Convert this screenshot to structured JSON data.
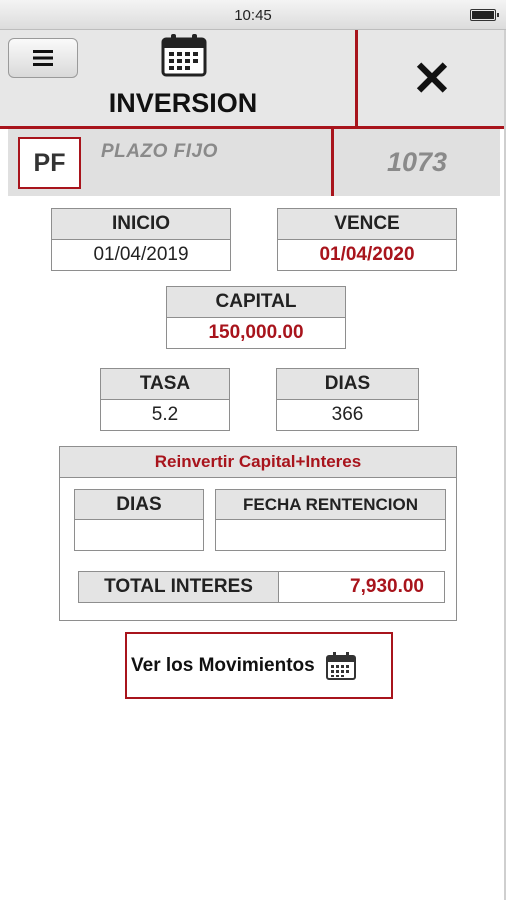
{
  "status_bar": {
    "time": "10:45",
    "battery_icon": "battery-icon"
  },
  "header": {
    "menu_icon": "hamburger-icon",
    "calendar_icon": "calendar-icon",
    "title": "INVERSION",
    "close_icon": "close-icon",
    "close_glyph": "✕"
  },
  "product": {
    "badge": "PF",
    "name": "PLAZO FIJO",
    "number": "1073"
  },
  "fields": {
    "inicio": {
      "label": "INICIO",
      "value": "01/04/2019"
    },
    "vence": {
      "label": "VENCE",
      "value": "01/04/2020"
    },
    "capital": {
      "label": "CAPITAL",
      "value": "150,000.00"
    },
    "tasa": {
      "label": "TASA",
      "value": "5.2"
    },
    "dias": {
      "label": "DIAS",
      "value": "366"
    }
  },
  "reinvest": {
    "title": "Reinvertir Capital+Interes",
    "dias": {
      "label": "DIAS",
      "value": ""
    },
    "fecha": {
      "label": "FECHA RENTENCION",
      "value": ""
    },
    "total": {
      "label": "TOTAL INTERES",
      "value": "7,930.00"
    }
  },
  "movimientos": {
    "label": "Ver los Movimientos",
    "icon": "calendar-icon"
  },
  "colors": {
    "accent": "#a8141c",
    "header_bg": "#e7e7e7",
    "label_bg": "#e4e4e4",
    "muted_text": "#8a8a8a"
  }
}
